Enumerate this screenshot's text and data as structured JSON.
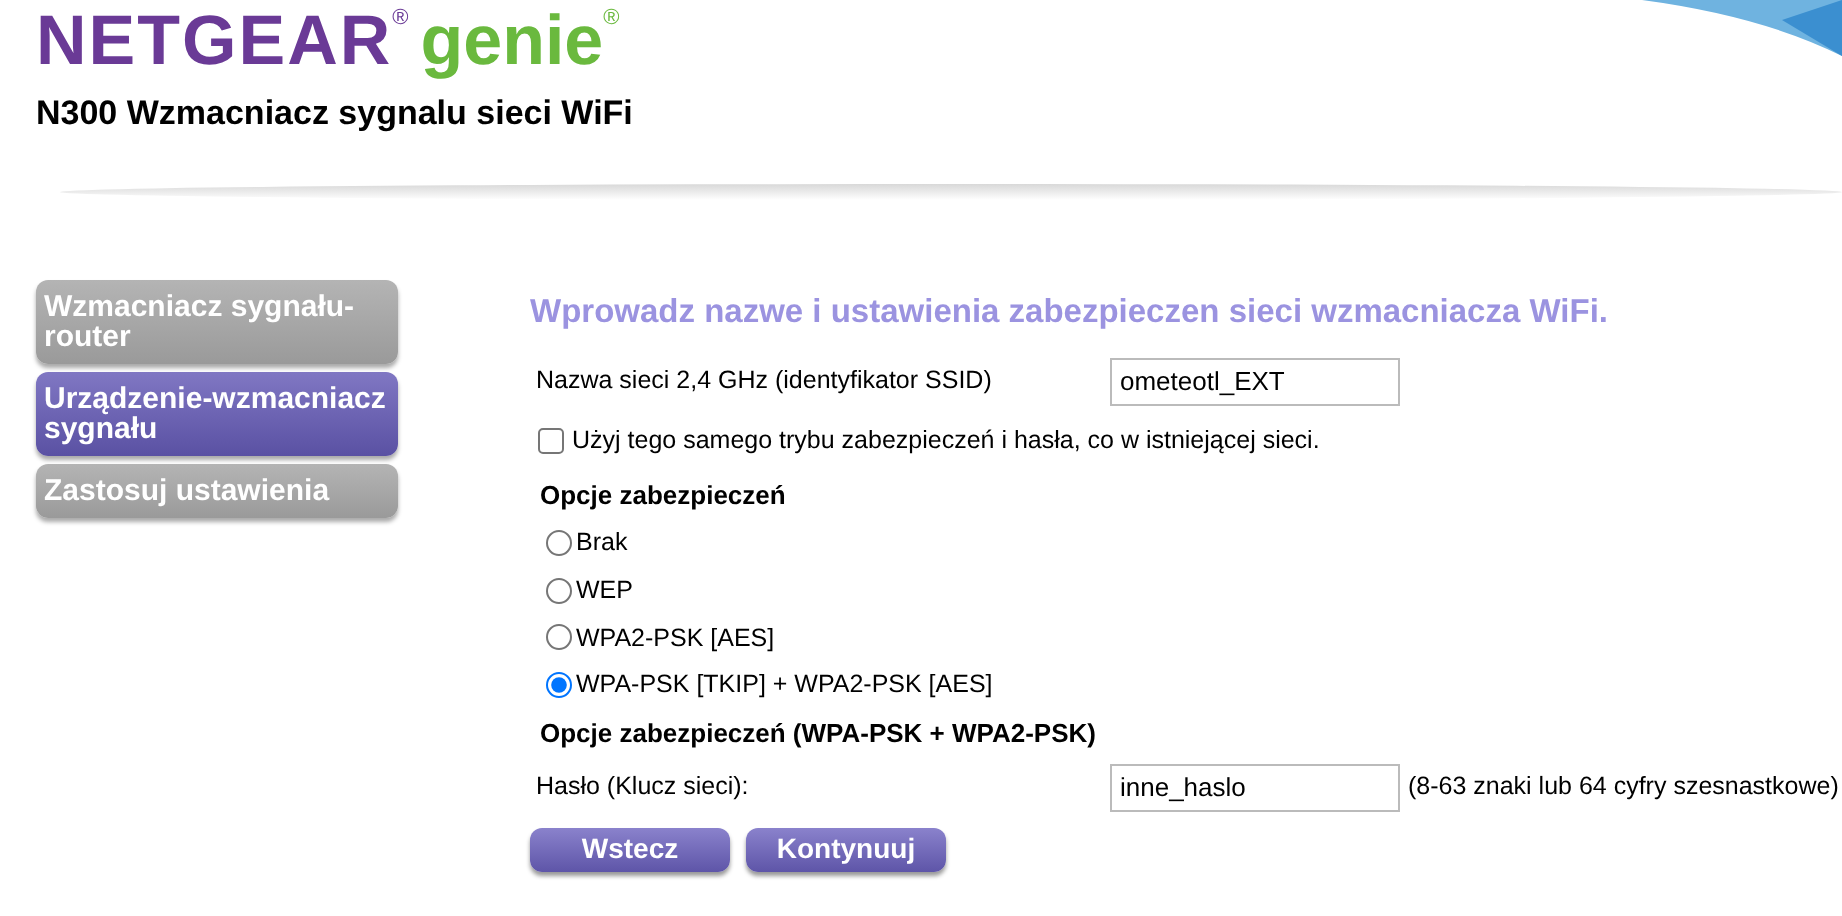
{
  "header": {
    "brand": "NETGEAR",
    "brand_mark": "®",
    "product": "genie",
    "product_mark": "®",
    "subtitle": "N300 Wzmacniacz sygnalu sieci WiFi"
  },
  "sidebar": {
    "items": [
      {
        "label": "Wzmacniacz sygnału-router",
        "selected": false
      },
      {
        "label": "Urządzenie-wzmacniacz sygnału",
        "selected": true
      },
      {
        "label": "Zastosuj ustawienia",
        "selected": false
      }
    ]
  },
  "form": {
    "title": "Wprowadz nazwe i ustawienia zabezpieczen sieci wzmacniacza WiFi.",
    "ssid": {
      "label": "Nazwa sieci 2,4 GHz (identyfikator SSID)",
      "value": "ometeotl_EXT"
    },
    "same_security": {
      "label": "Użyj tego samego trybu zabezpieczeń i hasła, co w istniejącej sieci.",
      "checked": false
    },
    "security_heading": "Opcje zabezpieczeń",
    "security_options": [
      {
        "label": "Brak",
        "selected": false
      },
      {
        "label": "WEP",
        "selected": false
      },
      {
        "label": "WPA2-PSK [AES]",
        "selected": false
      },
      {
        "label": "WPA-PSK [TKIP] + WPA2-PSK [AES]",
        "selected": true
      }
    ],
    "options_heading": "Opcje zabezpieczeń (WPA-PSK + WPA2-PSK)",
    "password": {
      "label": "Hasło (Klucz sieci):",
      "value": "inne_haslo",
      "hint": "(8-63 znaki lub 64 cyfry szesnastkowe)"
    },
    "buttons": [
      "Wstecz",
      "Kontynuuj"
    ]
  }
}
